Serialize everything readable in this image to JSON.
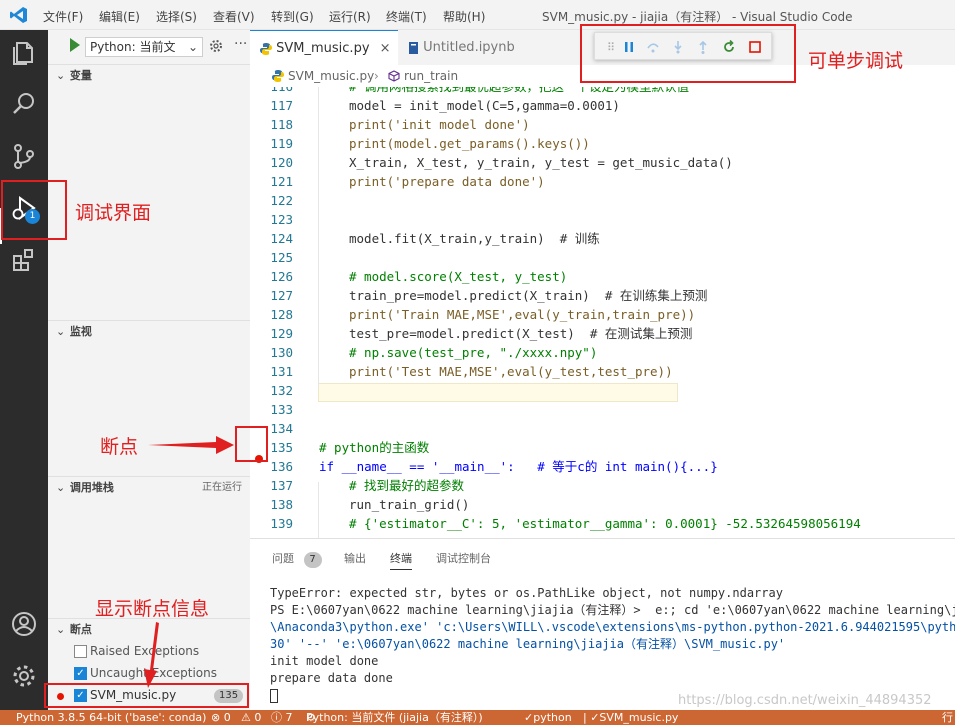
{
  "titlebar": {
    "menus": [
      "文件(F)",
      "编辑(E)",
      "选择(S)",
      "查看(V)",
      "转到(G)",
      "运行(R)",
      "终端(T)",
      "帮助(H)"
    ],
    "title": "SVM_music.py - jiajia（有注释） - Visual Studio Code"
  },
  "activity": {
    "debug_badge": "1"
  },
  "sidebar": {
    "run_config": "Python: 当前文",
    "variables_header": "变量",
    "watch_header": "监视",
    "callstack_header": "调用堆栈",
    "callstack_status": "正在运行",
    "breakpoints_header": "断点",
    "breakpoints": [
      {
        "label": "Raised Exceptions",
        "checked": false
      },
      {
        "label": "Uncaught Exceptions",
        "checked": true
      },
      {
        "label": "SVM_music.py",
        "checked": true,
        "count": "135"
      }
    ]
  },
  "editor": {
    "tabs": [
      {
        "label": "SVM_music.py",
        "close": "×",
        "active": true
      },
      {
        "label": "Untitled.ipynb",
        "active": false
      }
    ],
    "breadcrumb": {
      "file": "SVM_music.py",
      "symbol": "run_train"
    },
    "lines": [
      {
        "n": "116",
        "t": "# 调用网格搜索找到最优超参数，把这一个设定为模型默认值"
      },
      {
        "n": "117",
        "t": "model = init_model(C=5,gamma=0.0001)"
      },
      {
        "n": "118",
        "t": "print('init model done')"
      },
      {
        "n": "119",
        "t": "print(model.get_params().keys())"
      },
      {
        "n": "120",
        "t": "X_train, X_test, y_train, y_test = get_music_data()"
      },
      {
        "n": "121",
        "t": "print('prepare data done')"
      },
      {
        "n": "122",
        "t": ""
      },
      {
        "n": "123",
        "t": ""
      },
      {
        "n": "124",
        "t": "model.fit(X_train,y_train)  # 训练"
      },
      {
        "n": "125",
        "t": ""
      },
      {
        "n": "126",
        "t": "# model.score(X_test, y_test)"
      },
      {
        "n": "127",
        "t": "train_pre=model.predict(X_train)  # 在训练集上预测"
      },
      {
        "n": "128",
        "t": "print('Train MAE,MSE',eval(y_train,train_pre))"
      },
      {
        "n": "129",
        "t": "test_pre=model.predict(X_test)  # 在测试集上预测"
      },
      {
        "n": "130",
        "t": "# np.save(test_pre, \"./xxxx.npy\")"
      },
      {
        "n": "131",
        "t": "print('Test MAE,MSE',eval(y_test,test_pre))"
      },
      {
        "n": "132",
        "t": ""
      },
      {
        "n": "133",
        "t": ""
      },
      {
        "n": "134",
        "t": ""
      },
      {
        "n": "135",
        "t": "# python的主函数"
      },
      {
        "n": "136",
        "t": "if __name__ == '__main__':   # 等于c的 int main(){...}"
      },
      {
        "n": "137",
        "t": "# 找到最好的超参数"
      },
      {
        "n": "138",
        "t": "run_train_grid()"
      },
      {
        "n": "139",
        "t": "# {'estimator__C': 5, 'estimator__gamma': 0.0001} -52.53264598056194"
      }
    ]
  },
  "panel": {
    "tabs": [
      {
        "label": "问题",
        "badge": "7"
      },
      {
        "label": "输出"
      },
      {
        "label": "终端",
        "active": true
      },
      {
        "label": "调试控制台"
      }
    ],
    "terminal_lines": [
      "TypeError: expected str, bytes or os.PathLike object, not numpy.ndarray",
      "PS E:\\0607yan\\0622 machine learning\\jiajia（有注释）>  e:; cd 'e:\\0607yan\\0622 machine learning\\jiajia（有注释）'; & 'E:",
      "\\Anaconda3\\python.exe' 'c:\\Users\\WILL\\.vscode\\extensions\\ms-python.python-2021.6.944021595\\pythonFiles\\lib\\python\\debugpy\\launcher' '539",
      "30' '--' 'e:\\0607yan\\0622 machine learning\\jiajia（有注释）\\SVM_music.py'",
      "init model done",
      "prepare data done"
    ]
  },
  "statusbar": {
    "interpreter": "Python 3.8.5 64-bit ('base': conda)",
    "errors": "⊗ 0",
    "warnings": "⚠ 0",
    "info": "ⓘ 7",
    "run_config": "Python: 当前文件 (jiajia（有注释）)",
    "language": "python",
    "file": "SVM_music.py",
    "right": "行"
  },
  "annotations": {
    "debug_view": "调试界面",
    "step_debug": "可单步调试",
    "breakpoint": "断点",
    "show_breakpoints": "显示断点信息"
  },
  "watermark": "https://blog.csdn.net/weixin_44894352",
  "colors": {
    "status_bar": "#cc6633",
    "activity_bar": "#2c2c2c",
    "annotation_red": "#e02020",
    "breakpoint_red": "#e51400",
    "current_line_bg": "#fffbe6"
  }
}
